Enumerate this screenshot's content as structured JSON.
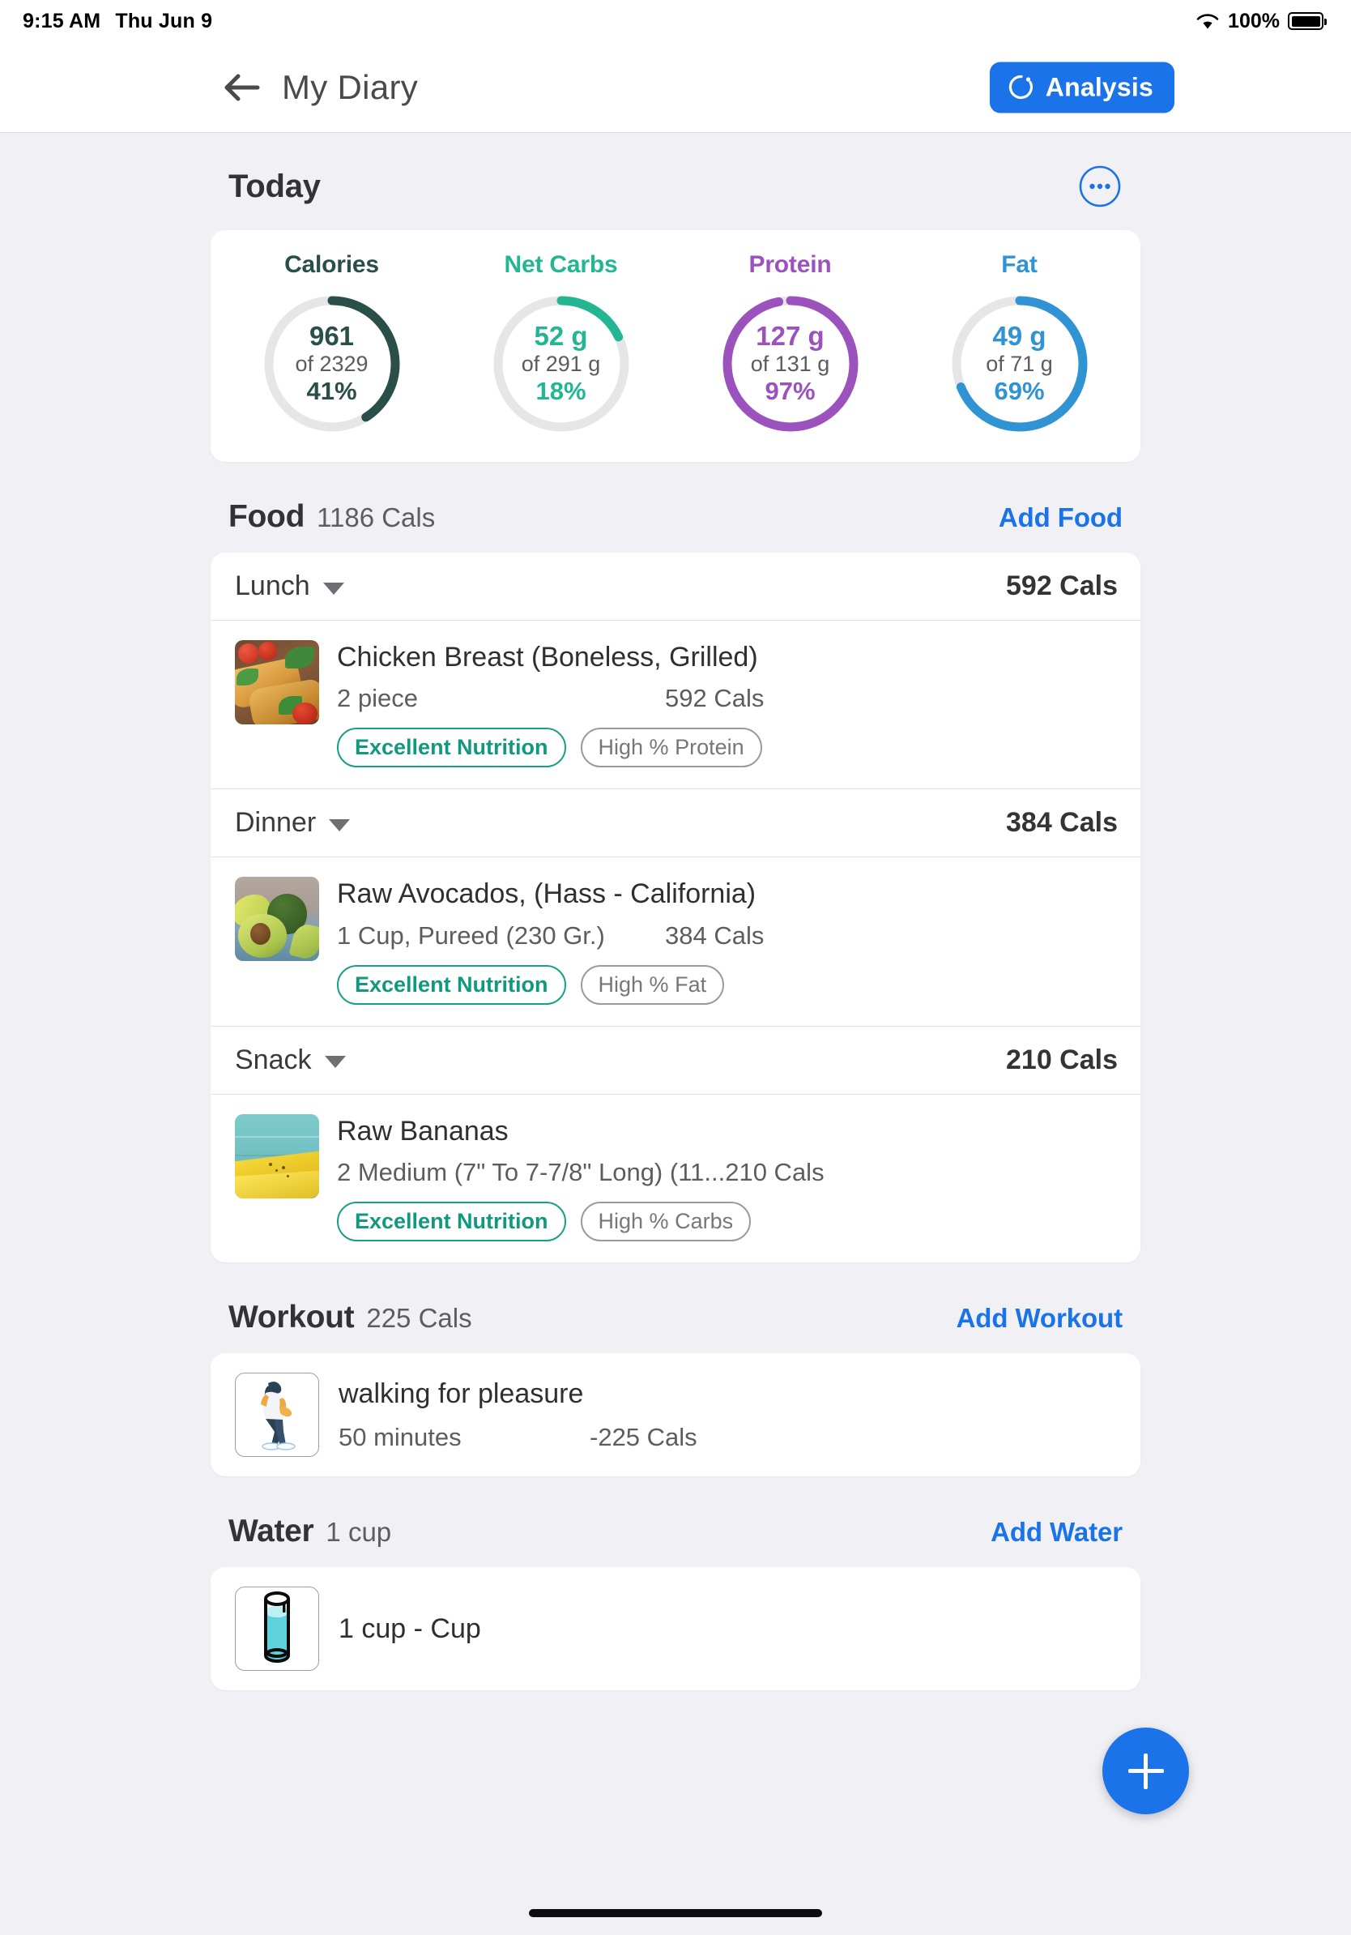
{
  "status_bar": {
    "time": "9:15 AM",
    "date": "Thu Jun 9",
    "battery_percent": "100%",
    "wifi_icon": "wifi-icon",
    "battery_icon": "battery-full-icon"
  },
  "nav": {
    "back_icon": "back-arrow-icon",
    "title": "My Diary",
    "analysis_label": "Analysis",
    "analysis_icon": "analysis-progress-icon",
    "accent": "#1a73e8"
  },
  "today": {
    "title": "Today",
    "more_icon": "more-options-icon"
  },
  "chart_data": {
    "type": "pie",
    "title": "Today",
    "rings": [
      {
        "label": "Calories",
        "value": "961",
        "goal": "of 2329",
        "percent_label": "41%",
        "percent": 41,
        "color": "#2a4f48",
        "track": "#e6e6e8"
      },
      {
        "label": "Net Carbs",
        "value": "52 g",
        "goal": "of 291 g",
        "percent_label": "18%",
        "percent": 18,
        "color": "#24b693",
        "track": "#e6e6e8"
      },
      {
        "label": "Protein",
        "value": "127 g",
        "goal": "of 131 g",
        "percent_label": "97%",
        "percent": 97,
        "color": "#9b52bd",
        "track": "#e6e6e8"
      },
      {
        "label": "Fat",
        "value": "49 g",
        "goal": "of 71 g",
        "percent_label": "69%",
        "percent": 69,
        "color": "#2f93d4",
        "track": "#e6e6e8"
      }
    ]
  },
  "food": {
    "title": "Food",
    "subtitle": "1186 Cals",
    "action": "Add Food",
    "meals": [
      {
        "name": "Lunch",
        "cals": "592 Cals",
        "items": [
          {
            "name": "Chicken Breast (Boneless, Grilled)",
            "serving": "2  piece",
            "cals": "592 Cals",
            "badge_primary": "Excellent Nutrition",
            "badge_secondary": "High % Protein",
            "thumb": "chicken-breast-photo"
          }
        ]
      },
      {
        "name": "Dinner",
        "cals": "384 Cals",
        "items": [
          {
            "name": "Raw Avocados, (Hass - California)",
            "serving": "1  Cup, Pureed (230 Gr.)",
            "cals": "384 Cals",
            "badge_primary": "Excellent Nutrition",
            "badge_secondary": "High % Fat",
            "thumb": "avocado-photo"
          }
        ]
      },
      {
        "name": "Snack",
        "cals": "210 Cals",
        "items": [
          {
            "name": "Raw Bananas",
            "serving": "2  Medium (7\" To 7-7/8\" Long) (11...",
            "cals": "210 Cals",
            "badge_primary": "Excellent Nutrition",
            "badge_secondary": "High % Carbs",
            "thumb": "banana-photo"
          }
        ]
      }
    ]
  },
  "workout": {
    "title": "Workout",
    "subtitle": "225 Cals",
    "action": "Add Workout",
    "item": {
      "name": "walking for pleasure",
      "duration": "50 minutes",
      "cals": "-225 Cals",
      "icon": "walking-person-icon"
    }
  },
  "water": {
    "title": "Water",
    "subtitle": "1 cup",
    "action": "Add Water",
    "item": {
      "label": "1 cup - Cup",
      "icon": "water-glass-icon"
    }
  },
  "fab": {
    "icon": "plus-icon",
    "color": "#1a73e8"
  }
}
